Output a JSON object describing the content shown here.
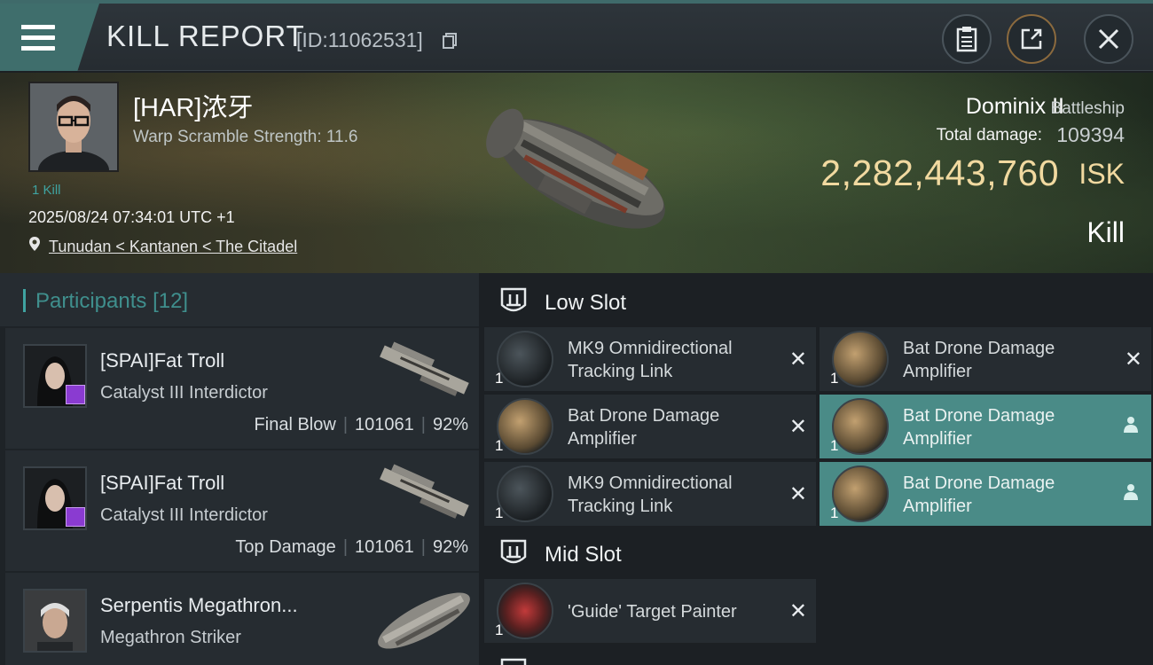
{
  "header": {
    "title": "KILL REPORT",
    "report_id": "[ID:11062531]",
    "icons": [
      "menu-icon",
      "copy-icon",
      "clipboard-icon",
      "share-icon",
      "close-icon"
    ]
  },
  "victim": {
    "name": "[HAR]浓牙",
    "warp_scramble": "Warp Scramble Strength: 11.6",
    "kills": "1 Kill",
    "datetime": "2025/08/24 07:34:01 UTC +1",
    "location": "Tunudan < Kantanen < The Citadel",
    "ship_name": "Dominix II",
    "ship_class": "Battleship",
    "damage_label": "Total damage:",
    "damage_value": "109394",
    "isk_value": "2,282,443,760",
    "isk_unit": "ISK",
    "outcome": "Kill"
  },
  "participants": {
    "title": "Participants",
    "count": "[12]",
    "rows": [
      {
        "name": "[SPAI]Fat Troll",
        "ship": "Catalyst III Interdictor",
        "role": "Final Blow",
        "damage": "101061",
        "percent": "92%"
      },
      {
        "name": "[SPAI]Fat Troll",
        "ship": "Catalyst III Interdictor",
        "role": "Top Damage",
        "damage": "101061",
        "percent": "92%"
      },
      {
        "name": "Serpentis Megathron...",
        "ship": "Megathron Striker"
      }
    ]
  },
  "slots": {
    "low": {
      "title": "Low Slot",
      "modules": [
        {
          "qty": "1",
          "name": "MK9 Omnidirectional Tracking Link"
        },
        {
          "qty": "1",
          "name": "Bat Drone Damage Amplifier"
        },
        {
          "qty": "1",
          "name": "Bat Drone Damage Amplifier"
        },
        {
          "qty": "1",
          "name": "Bat Drone Damage Amplifier"
        },
        {
          "qty": "1",
          "name": "MK9 Omnidirectional Tracking Link"
        },
        {
          "qty": "1",
          "name": "Bat Drone Damage Amplifier"
        }
      ]
    },
    "mid": {
      "title": "Mid Slot",
      "modules": [
        {
          "qty": "1",
          "name": "'Guide' Target Painter"
        }
      ]
    }
  },
  "colors": {
    "accent_teal": "#3fa3a1",
    "isk_gold": "#f1d9a0",
    "highlight_row": "#4a8b87",
    "badge_purple": "#8a3bd1"
  }
}
